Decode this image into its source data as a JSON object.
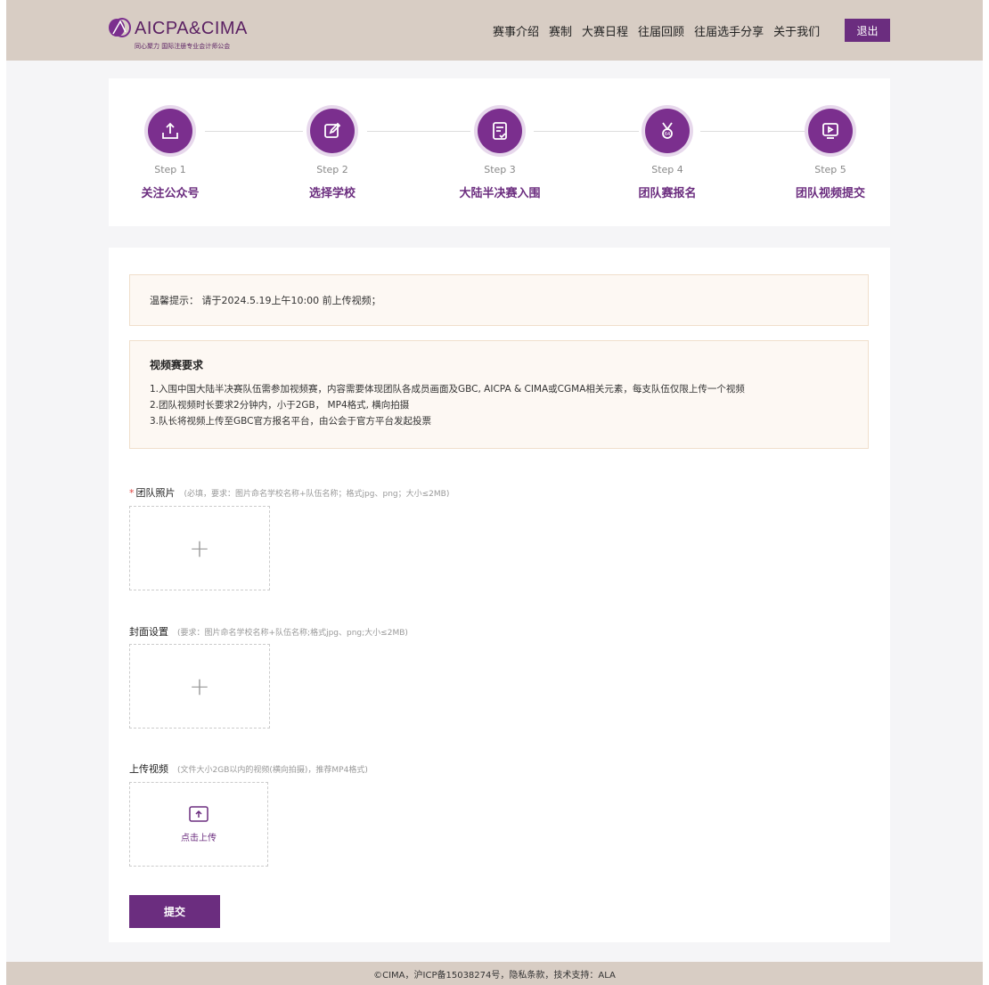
{
  "header": {
    "logo_text": "AICPA&CIMA",
    "logo_sub": "同心聚力  国际注册专业会计师公会",
    "nav": [
      "赛事介绍",
      "赛制",
      "大赛日程",
      "往届回顾",
      "往届选手分享",
      "关于我们"
    ],
    "logout_label": "退出"
  },
  "steps": [
    {
      "num": "Step 1",
      "title": "关注公众号",
      "icon": "upload-icon"
    },
    {
      "num": "Step 2",
      "title": "选择学校",
      "icon": "edit-icon"
    },
    {
      "num": "Step 3",
      "title": "大陆半决赛入围",
      "icon": "checklist-icon"
    },
    {
      "num": "Step 4",
      "title": "团队赛报名",
      "icon": "medal-icon"
    },
    {
      "num": "Step 5",
      "title": "团队视频提交",
      "icon": "video-icon"
    }
  ],
  "notice": "温馨提示：  请于2024.5.19上午10:00 前上传视频；",
  "requirements": {
    "title": "视频赛要求",
    "lines": [
      "1.入围中国大陆半决赛队伍需参加视频赛，内容需要体现团队各成员画面及GBC, AICPA & CIMA或CGMA相关元素，每支队伍仅限上传一个视频",
      "2.团队视频时长要求2分钟内，小于2GB，  MP4格式, 横向拍摄",
      "3.队长将视频上传至GBC官方报名平台，由公会于官方平台发起投票"
    ]
  },
  "fields": {
    "team_photo": {
      "required_mark": "*",
      "label": "团队照片",
      "hint": "(必填，要求：图片命名学校名称+队伍名称；格式jpg、png；大小≤2MB)"
    },
    "cover": {
      "label": "封面设置",
      "hint": "(要求：图片命名学校名称+队伍名称;格式jpg、png;大小≤2MB)"
    },
    "video": {
      "label": "上传视频",
      "hint": "(文件大小2GB以内的视频(横向拍摄)，推荐MP4格式)",
      "upload_text": "点击上传"
    }
  },
  "submit_label": "提交",
  "footer": "©CIMA，沪ICP备15038274号，隐私条款，技术支持：ALA",
  "colors": {
    "brand": "#6b2d7f",
    "header_bg": "#d8cdc4",
    "notice_bg": "#fdf8f3"
  }
}
